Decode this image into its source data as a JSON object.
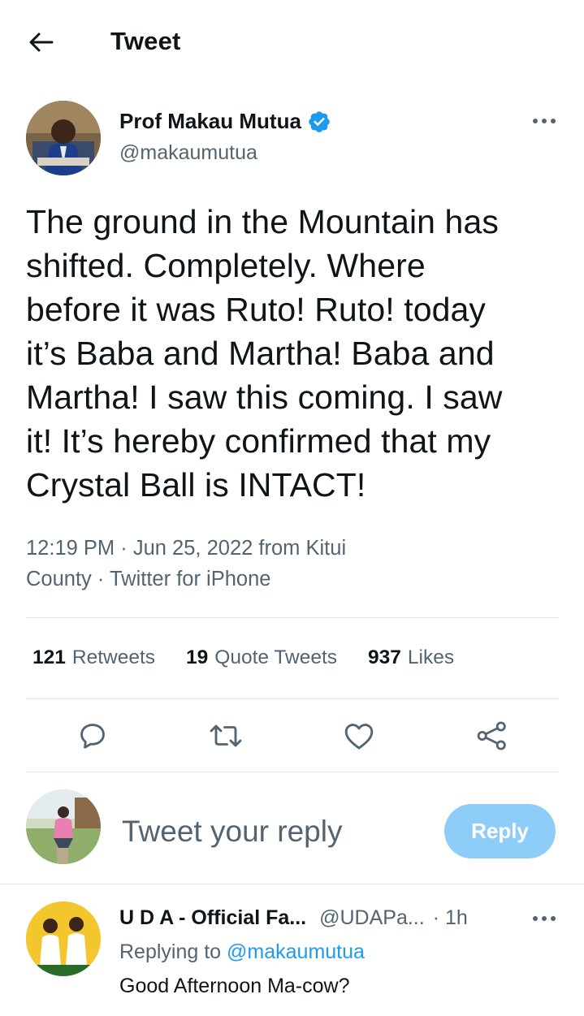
{
  "header": {
    "title": "Tweet",
    "back_icon": "arrow-left-icon"
  },
  "tweet": {
    "author_name": "Prof Makau Mutua",
    "author_handle": "@makaumutua",
    "verified_icon": "verified-badge-icon",
    "text": "The ground in the Mountain has\nshifted.  Completely.  Where\nbefore it was Ruto! Ruto! today\nit’s Baba and Martha!  Baba and\nMartha!  I saw this coming.  I saw\nit!  It’s hereby confirmed that my\nCrystal Ball is INTACT!",
    "time": "12:19 PM",
    "separator": "·",
    "date": "Jun 25, 2022",
    "from_label": "from",
    "location_part1": "Kitui",
    "location_part2": "County",
    "source": "Twitter for iPhone"
  },
  "stats": {
    "retweets_count": "121",
    "retweets_label": "Retweets",
    "quotes_count": "19",
    "quotes_label": "Quote Tweets",
    "likes_count": "937",
    "likes_label": "Likes"
  },
  "actions": [
    {
      "name": "reply-icon"
    },
    {
      "name": "retweet-icon"
    },
    {
      "name": "like-icon"
    },
    {
      "name": "share-icon"
    }
  ],
  "composer": {
    "placeholder": "Tweet your reply",
    "button_label": "Reply",
    "button_color": "#8ecdf8"
  },
  "reply": {
    "author_name": "U D A - Official Fa...",
    "author_handle": "@UDAPa...",
    "time": "1h",
    "separator": "·",
    "replying_to_label": "Replying to",
    "replying_to_handle": "@makaumutua",
    "text": "Good Afternoon Ma-cow?"
  },
  "colors": {
    "accent": "#1d9bf0",
    "secondary_text": "#536471",
    "divider": "#e2e7ea"
  }
}
